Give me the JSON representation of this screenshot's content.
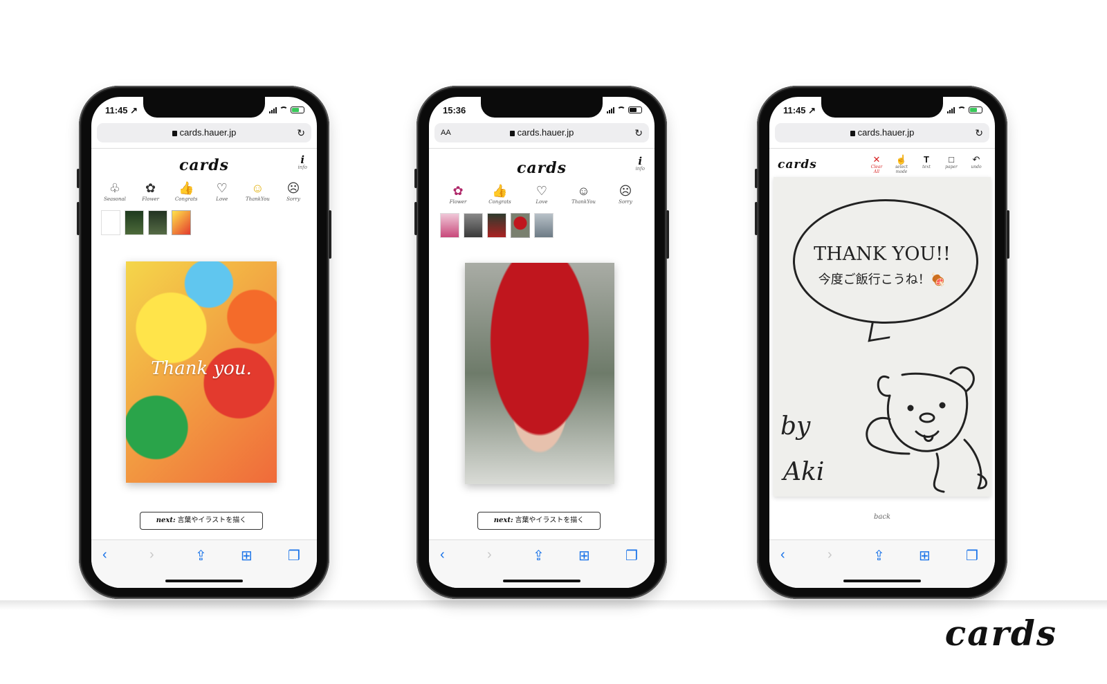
{
  "phones": [
    {
      "time": "11:45 ↗",
      "url": "cards.hauer.jp",
      "logo": "cards",
      "info_label": "info",
      "categories": [
        "Seasonal",
        "Flower",
        "Congrats",
        "Love",
        "ThankYou",
        "Sorry"
      ],
      "next_prefix": "next:",
      "next_text": "言葉やイラストを描く",
      "card_caption": "Thank you."
    },
    {
      "time": "15:36",
      "url": "cards.hauer.jp",
      "aa": "AA",
      "logo": "cards",
      "info_label": "info",
      "categories": [
        "Flower",
        "Congrats",
        "Love",
        "ThankYou",
        "Sorry"
      ],
      "next_prefix": "next:",
      "next_text": "言葉やイラストを描く"
    },
    {
      "time": "11:45 ↗",
      "url": "cards.hauer.jp",
      "logo": "cards",
      "tools": [
        "Clear All",
        "select mode",
        "text",
        "paper",
        "undo"
      ],
      "message_line1": "THANK YOU!!",
      "message_line2": "今度ご飯行こうね！🍖",
      "signature_by": "by",
      "signature_name": "Aki",
      "back_label": "back"
    }
  ],
  "brand": "cards",
  "colors": {
    "accent": "#1a73e8",
    "thankyou_active": "#e2b10e",
    "flower_active": "#b02a6b",
    "clear_all": "#d61e1e"
  }
}
